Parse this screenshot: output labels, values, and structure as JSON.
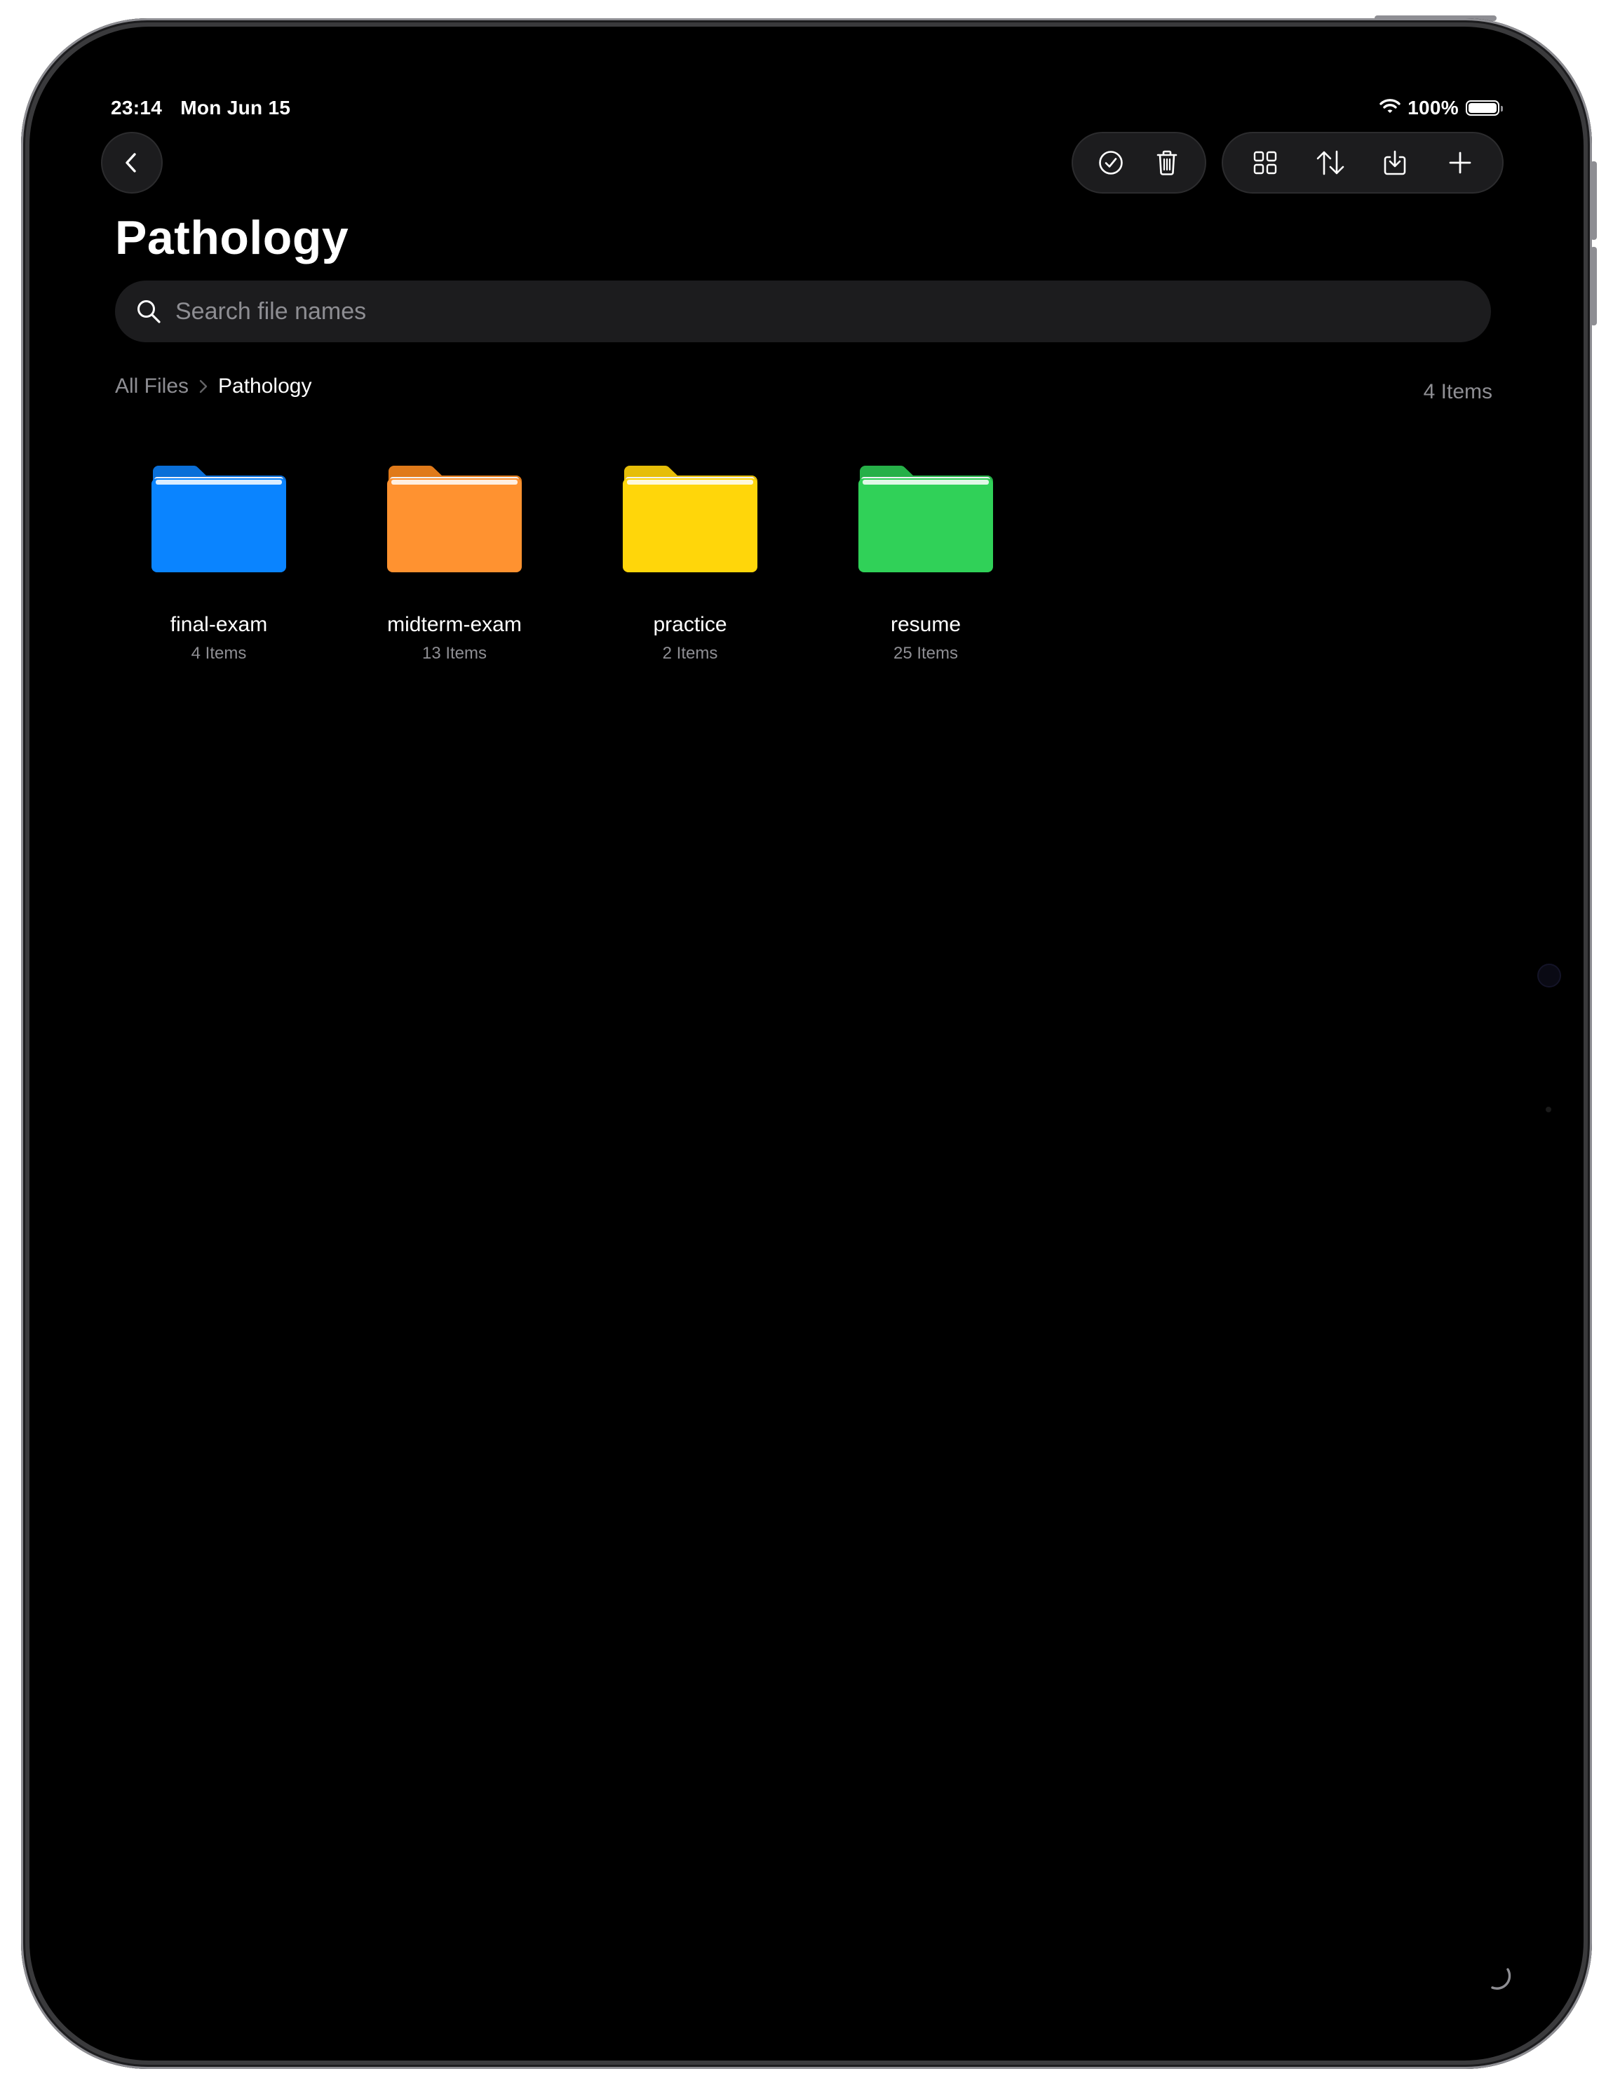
{
  "status_bar": {
    "time": "23:14",
    "date": "Mon Jun 15",
    "battery": "100%",
    "icons": [
      "wifi-icon",
      "battery-icon"
    ]
  },
  "nav": {
    "back_icon": "chevron-left-icon",
    "actions_group_1": [
      "select-checkmark-icon",
      "trash-icon"
    ],
    "actions_group_2": [
      "grid-view-icon",
      "sort-arrows-icon",
      "import-tray-icon",
      "plus-icon"
    ]
  },
  "page": {
    "title": "Pathology"
  },
  "search": {
    "placeholder": "Search file names",
    "value": ""
  },
  "breadcrumb": {
    "root": "All Files",
    "current": "Pathology"
  },
  "item_count": "4 Items",
  "folders": [
    {
      "name": "final-exam",
      "count": "4 Items",
      "color": "#0A84FF",
      "tab": "#0A6FD8"
    },
    {
      "name": "midterm-exam",
      "count": "13 Items",
      "color": "#FF9230",
      "tab": "#E07A1A"
    },
    {
      "name": "practice",
      "count": "2 Items",
      "color": "#FFD60A",
      "tab": "#E6BE08"
    },
    {
      "name": "resume",
      "count": "25 Items",
      "color": "#30D158",
      "tab": "#26B048"
    }
  ]
}
